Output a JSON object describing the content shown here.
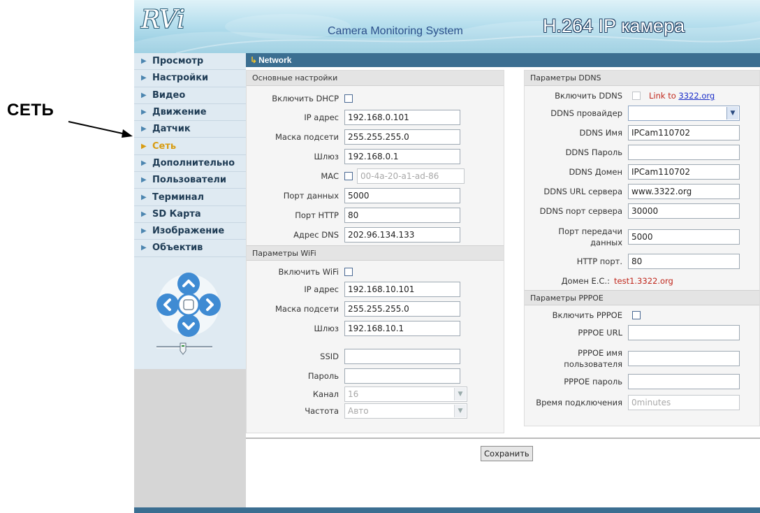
{
  "annotation": {
    "label": "СЕТЬ"
  },
  "header": {
    "logo": "RVi",
    "subtitle": "Camera Monitoring System",
    "product": "H.264 IP камера"
  },
  "sidebar": {
    "items": [
      {
        "label": "Просмотр"
      },
      {
        "label": "Настройки"
      },
      {
        "label": "Видео"
      },
      {
        "label": "Движение"
      },
      {
        "label": "Датчик"
      },
      {
        "label": "Сеть",
        "active": true
      },
      {
        "label": "Дополнительно"
      },
      {
        "label": "Пользователи"
      },
      {
        "label": "Терминал"
      },
      {
        "label": "SD Карта"
      },
      {
        "label": "Изображение"
      },
      {
        "label": "Объектив"
      }
    ]
  },
  "page": {
    "title": "Network"
  },
  "basic": {
    "title": "Основные настройки",
    "dhcp_label": "Включить DHCP",
    "ip_label": "IP адрес",
    "ip_value": "192.168.0.101",
    "mask_label": "Маска подсети",
    "mask_value": "255.255.255.0",
    "gateway_label": "Шлюз",
    "gateway_value": "192.168.0.1",
    "mac_label": "MAC",
    "mac_value": "00-4a-20-a1-ad-86",
    "data_port_label": "Порт данных",
    "data_port_value": "5000",
    "http_port_label": "Порт HTTP",
    "http_port_value": "80",
    "dns_label": "Адрес DNS",
    "dns_value": "202.96.134.133"
  },
  "wifi": {
    "title": "Параметры WiFi",
    "enable_label": "Включить WiFi",
    "ip_label": "IP адрес",
    "ip_value": "192.168.10.101",
    "mask_label": "Маска подсети",
    "mask_value": "255.255.255.0",
    "gateway_label": "Шлюз",
    "gateway_value": "192.168.10.1",
    "ssid_label": "SSID",
    "ssid_value": "",
    "password_label": "Пароль",
    "password_value": "",
    "channel_label": "Канал",
    "channel_value": "16",
    "freq_label": "Частота",
    "freq_value": "Авто"
  },
  "ddns": {
    "title": "Параметры DDNS",
    "enable_label": "Включить DDNS",
    "link_prefix": "Link to ",
    "link_text": "3322.org",
    "provider_label": "DDNS провайдер",
    "provider_value": "",
    "name_label": "DDNS Имя",
    "name_value": "IPCam110702",
    "password_label": "DDNS Пароль",
    "password_value": "",
    "domain_label": "DDNS Домен",
    "domain_value": "IPCam110702",
    "url_label": "DDNS URL сервера",
    "url_value": "www.3322.org",
    "server_port_label": "DDNS порт сервера",
    "server_port_value": "30000",
    "data_port_label_1": "Порт передачи",
    "data_port_label_2": "данных",
    "data_port_value": "5000",
    "http_port_label": "HTTP порт.",
    "http_port_value": "80",
    "domain_ec_label": "Домен E.C.:",
    "domain_ec_value": "test1.3322.org"
  },
  "pppoe": {
    "title": "Параметры PPPOE",
    "enable_label": "Включить PPPOE",
    "url_label": "PPPOE URL",
    "url_value": "",
    "user_label_1": "PPPOE имя",
    "user_label_2": "пользователя",
    "user_value": "",
    "password_label": "PPPOE пароль",
    "password_value": "",
    "time_label": "Время подключения",
    "time_value": "0minutes"
  },
  "actions": {
    "save_label": "Сохранить"
  },
  "colors": {
    "accent": "#3b6e91",
    "active_menu": "#d89c12",
    "link_red": "#c0271c"
  }
}
